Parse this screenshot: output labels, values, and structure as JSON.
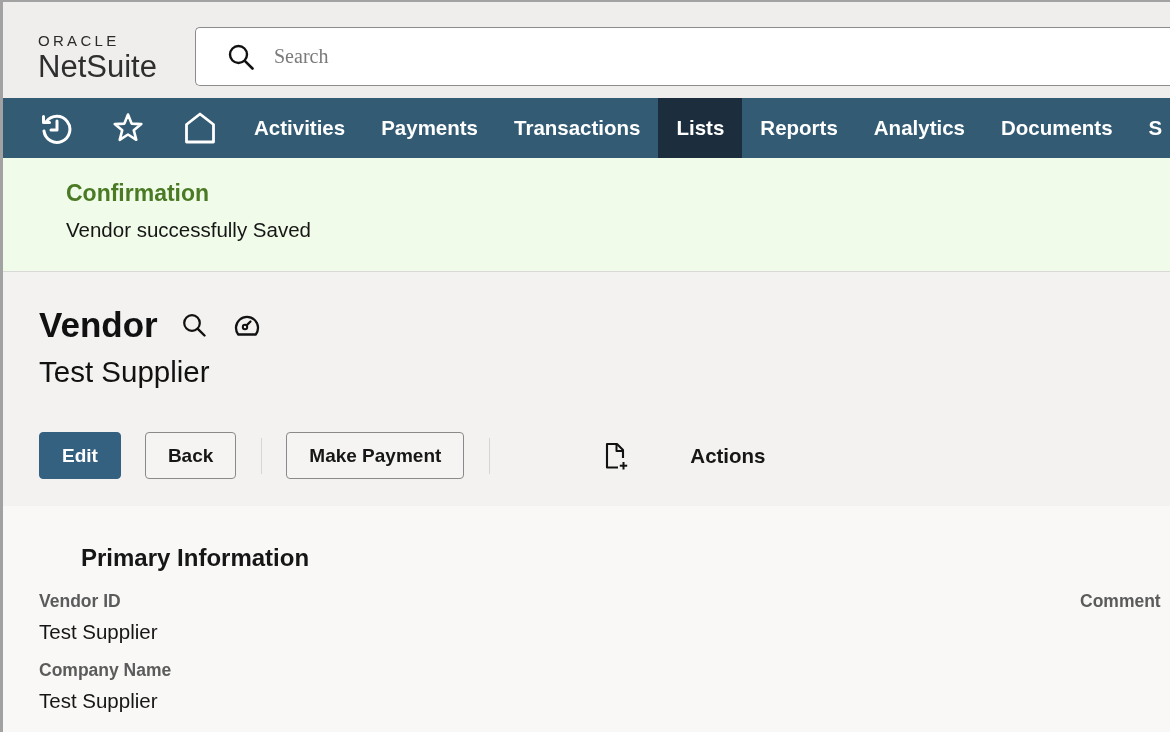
{
  "logo": {
    "brand": "ORACLE",
    "product": "NetSuite"
  },
  "search": {
    "placeholder": "Search"
  },
  "nav": {
    "items": [
      {
        "label": "Activities",
        "selected": false
      },
      {
        "label": "Payments",
        "selected": false
      },
      {
        "label": "Transactions",
        "selected": false
      },
      {
        "label": "Lists",
        "selected": true
      },
      {
        "label": "Reports",
        "selected": false
      },
      {
        "label": "Analytics",
        "selected": false
      },
      {
        "label": "Documents",
        "selected": false
      },
      {
        "label": "S",
        "selected": false
      }
    ]
  },
  "confirmation": {
    "title": "Confirmation",
    "message": "Vendor successfully Saved"
  },
  "record": {
    "type": "Vendor",
    "name": "Test Supplier",
    "toolbar": [
      {
        "kind": "primary",
        "label": "Edit"
      },
      {
        "kind": "secondary",
        "label": "Back"
      },
      {
        "kind": "divider"
      },
      {
        "kind": "secondary",
        "label": "Make Payment"
      },
      {
        "kind": "divider"
      },
      {
        "kind": "icon"
      },
      {
        "kind": "menu",
        "label": "Actions"
      }
    ]
  },
  "primary_information": {
    "title": "Primary Information",
    "fields": [
      {
        "label": "Vendor ID",
        "value": "Test Supplier"
      },
      {
        "label": "Company Name",
        "value": "Test Supplier"
      }
    ],
    "column_2_fields": [
      {
        "label": "Comment"
      }
    ]
  }
}
